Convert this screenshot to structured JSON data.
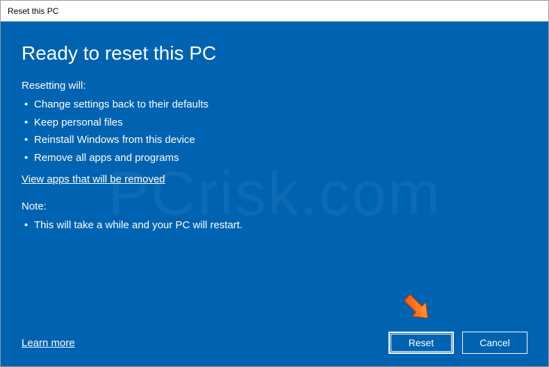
{
  "window": {
    "title": "Reset this PC"
  },
  "dialog": {
    "heading": "Ready to reset this PC",
    "intro": "Resetting will:",
    "bullets": [
      "Change settings back to their defaults",
      "Keep personal files",
      "Reinstall Windows from this device",
      "Remove all apps and programs"
    ],
    "view_apps_link": "View apps that will be removed",
    "note_label": "Note:",
    "note_bullets": [
      "This will take a while and your PC will restart."
    ],
    "learn_more_link": "Learn more"
  },
  "buttons": {
    "reset": "Reset",
    "cancel": "Cancel"
  },
  "annotation": {
    "arrow_color": "#ff6a00"
  }
}
